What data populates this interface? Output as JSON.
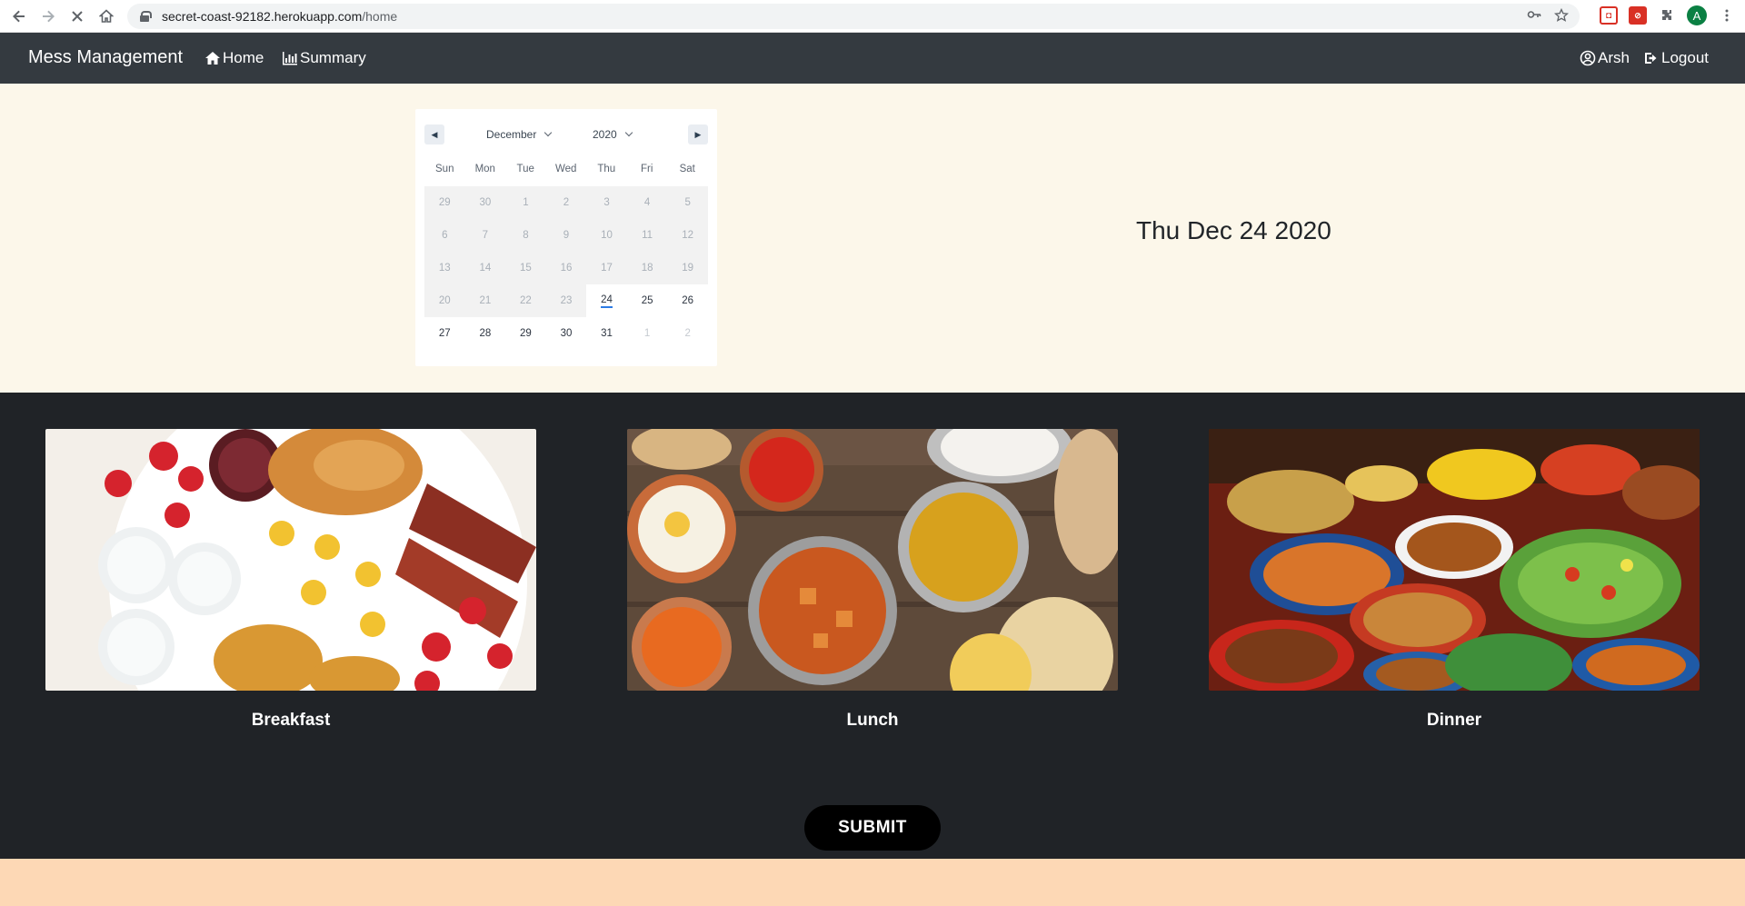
{
  "browser": {
    "url_host": "secret-coast-92182.herokuapp.com",
    "url_path": "/home",
    "profile_initial": "A"
  },
  "navbar": {
    "brand": "Mess Management",
    "home_label": "Home",
    "summary_label": "Summary",
    "user_label": "Arsh",
    "logout_label": "Logout"
  },
  "calendar": {
    "month": "December",
    "year": "2020",
    "weekdays": [
      "Sun",
      "Mon",
      "Tue",
      "Wed",
      "Thu",
      "Fri",
      "Sat"
    ],
    "weeks": [
      [
        "29",
        "30",
        "1",
        "2",
        "3",
        "4",
        "5"
      ],
      [
        "6",
        "7",
        "8",
        "9",
        "10",
        "11",
        "12"
      ],
      [
        "13",
        "14",
        "15",
        "16",
        "17",
        "18",
        "19"
      ],
      [
        "20",
        "21",
        "22",
        "23",
        "24",
        "25",
        "26"
      ],
      [
        "27",
        "28",
        "29",
        "30",
        "31",
        "1",
        "2"
      ]
    ],
    "today": "24"
  },
  "selected_date": "Thu Dec 24 2020",
  "meals": [
    {
      "label": "Breakfast"
    },
    {
      "label": "Lunch"
    },
    {
      "label": "Dinner"
    }
  ],
  "submit_label": "SUBMIT",
  "colors": {
    "navbar": "#343a40",
    "calendar_bg": "#fcf7ea",
    "meals_bg": "#202327",
    "footer": "#fdd8b5",
    "today_underline": "#2b7be5"
  }
}
